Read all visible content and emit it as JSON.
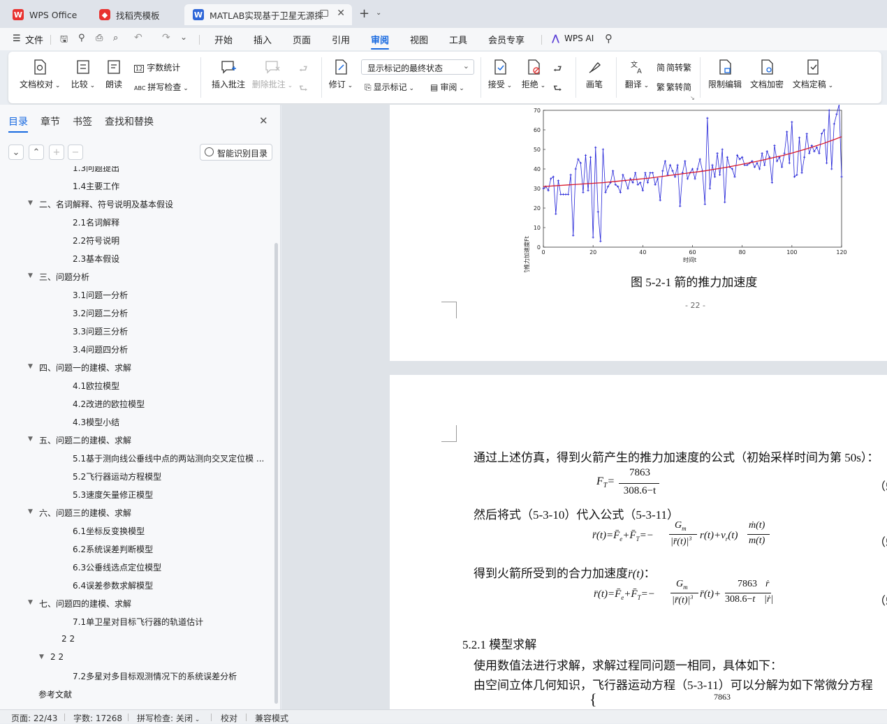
{
  "tabs": [
    {
      "label": "WPS Office"
    },
    {
      "label": "找稻壳模板"
    },
    {
      "label": "MATLAB实现基于卫星无源探"
    }
  ],
  "menu": {
    "file": "文件",
    "items": [
      "开始",
      "插入",
      "页面",
      "引用",
      "审阅",
      "视图",
      "工具",
      "会员专享"
    ],
    "wps_ai": "WPS AI"
  },
  "ribbon": {
    "doc_check": "文档校对",
    "compare": "比较",
    "read_aloud": "朗读",
    "word_count": "字数统计",
    "spell_check": "拼写检查",
    "insert_comment": "插入批注",
    "delete_comment": "删除批注",
    "revise": "修订",
    "markup_state": "显示标记的最终状态",
    "show_markup": "显示标记",
    "review": "审阅",
    "accept": "接受",
    "reject": "拒绝",
    "pen": "画笔",
    "translate": "翻译",
    "to_traditional": "简转繁",
    "to_simplified": "繁转简",
    "restrict_edit": "限制编辑",
    "encrypt": "文档加密",
    "finalize": "文档定稿"
  },
  "panel": {
    "tabs": [
      "目录",
      "章节",
      "书签",
      "查找和替换"
    ],
    "smart_toc": "智能识别目录",
    "toc": [
      {
        "text": "1.3问题提出",
        "level": 2
      },
      {
        "text": "1.4主要工作",
        "level": 2
      },
      {
        "text": "二、名词解释、符号说明及基本假设",
        "level": 1
      },
      {
        "text": "2.1名词解释",
        "level": 2
      },
      {
        "text": "2.2符号说明",
        "level": 2
      },
      {
        "text": "2.3基本假设",
        "level": 2
      },
      {
        "text": "三、问题分析",
        "level": 1
      },
      {
        "text": "3.1问题一分析",
        "level": 2
      },
      {
        "text": "3.2问题二分析",
        "level": 2
      },
      {
        "text": "3.3问题三分析",
        "level": 2
      },
      {
        "text": "3.4问题四分析",
        "level": 2
      },
      {
        "text": "四、问题一的建模、求解",
        "level": 1
      },
      {
        "text": "4.1欧拉模型",
        "level": 2
      },
      {
        "text": "4.2改进的欧拉模型",
        "level": 2
      },
      {
        "text": "4.3模型小结",
        "level": 2
      },
      {
        "text": "五、问题二的建模、求解",
        "level": 1
      },
      {
        "text": "5.1基于测向线公垂线中点的两站测向交叉定位模 ...",
        "level": 2
      },
      {
        "text": "5.2飞行器运动方程模型",
        "level": 2
      },
      {
        "text": "5.3速度矢量修正模型",
        "level": 2
      },
      {
        "text": "六、问题三的建模、求解",
        "level": 1
      },
      {
        "text": "6.1坐标反变换模型",
        "level": 2
      },
      {
        "text": "6.2系统误差判断模型",
        "level": 2
      },
      {
        "text": "6.3公垂线选点定位模型",
        "level": 2
      },
      {
        "text": "6.4误差参数求解模型",
        "level": 2
      },
      {
        "text": "七、问题四的建模、求解",
        "level": 1
      },
      {
        "text": "7.1单卫星对目标飞行器的轨道估计",
        "level": 2
      },
      {
        "text": "2 2",
        "level": 3
      },
      {
        "text": "2 2",
        "level": 4
      },
      {
        "text": "7.2多星对多目标观测情况下的系统误差分析",
        "level": 2
      },
      {
        "text": "参考文献",
        "level": 0
      }
    ]
  },
  "document": {
    "figure_caption": "图  5-2-1  箭的推力加速度",
    "page_number": "- 22 -",
    "para1": "通过上述仿真，得到火箭产生的推力加速度的公式（初始采样时间为第 50s）：",
    "para2": "然后将式（5-3-10）代入公式（5-3-11）",
    "para3": "得到火箭所受到的合力加速度",
    "section": "5.2.1  模型求解",
    "para4": "使用数值法进行求解，求解过程同问题一相同，具体如下：",
    "para5": "由空间立体几何知识，飞行器运动方程（5-3-11）可以分解为如下常微分方程",
    "eq_num": "（5",
    "eq1_num": "7863",
    "eq1_den": "308.6−t"
  },
  "chart_data": {
    "type": "line",
    "ylabel": "火箭的推力加速度Ft",
    "xlabel": "时间t",
    "xlim": [
      0,
      120
    ],
    "ylim": [
      0,
      70
    ],
    "xticks": [
      0,
      20,
      40,
      60,
      80,
      100,
      120
    ],
    "yticks": [
      0,
      10,
      20,
      30,
      40,
      50,
      60,
      70
    ],
    "series": [
      {
        "values": [
          30,
          31,
          29,
          35,
          36,
          17,
          34,
          27,
          27,
          27,
          27,
          37,
          6,
          40,
          45,
          43,
          28,
          47,
          29,
          46,
          5,
          51,
          18,
          3,
          50,
          28,
          31,
          33,
          39,
          32,
          31,
          28,
          37,
          34,
          30,
          35,
          33,
          38,
          32,
          33,
          29,
          38,
          33,
          38,
          38,
          32,
          35,
          24,
          39,
          44,
          37,
          42,
          39,
          36,
          42,
          21,
          38,
          44,
          35,
          38,
          40,
          35,
          40,
          45,
          39,
          22,
          66,
          30,
          42,
          36,
          48,
          37,
          50,
          23,
          46,
          41,
          40,
          36,
          47,
          45,
          46,
          42,
          42,
          43,
          44,
          41,
          43,
          40,
          48,
          42,
          49,
          46,
          33,
          52,
          44,
          46,
          41,
          48,
          59,
          43,
          64,
          36,
          37,
          56,
          38,
          46,
          58,
          48,
          52,
          49,
          51,
          48,
          58,
          60,
          43,
          70,
          40,
          63,
          68,
          73,
          36
        ]
      },
      {
        "values": [
          31,
          31.2,
          31.4,
          31.6,
          31.8,
          32,
          32.2,
          32.4,
          32.6,
          32.8,
          33,
          33.3,
          33.6,
          33.9,
          34.2,
          34.5,
          34.8,
          35.1,
          35.4,
          35.8,
          36.2,
          36.6,
          37,
          37.4,
          37.8,
          38.2,
          38.6,
          39,
          39.5,
          40,
          40.5,
          41,
          41.6,
          42.2,
          42.8,
          43.4,
          44,
          44.7,
          45.4,
          46.1,
          46.8,
          47.6,
          48.4,
          49.3,
          50.2,
          51.1,
          52.1,
          53.1,
          54.2,
          55.3,
          56.5
        ]
      }
    ]
  },
  "status": {
    "page": "页面: 22/43",
    "words": "字数: 17268",
    "spell": "拼写检查: 关闭",
    "proof": "校对",
    "compat": "兼容模式"
  }
}
